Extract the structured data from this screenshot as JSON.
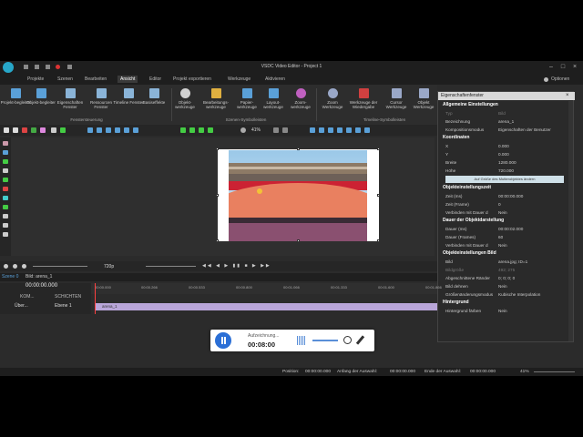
{
  "window": {
    "title": "VSDC Video Editor - Project 1"
  },
  "menu": {
    "items": [
      "Projekte",
      "Szenen",
      "Bearbeiten",
      "Ansicht",
      "Editor",
      "Projekt exportieren",
      "Werkzeuge",
      "Aktivieren"
    ],
    "options_label": "Optionen"
  },
  "ribbon": {
    "group1": [
      {
        "label": "Projekt-begleiter",
        "sub": "▾"
      },
      {
        "label": "Objekt-begleiter",
        "sub": "▾"
      },
      {
        "label": "Eigenschaften Fenster",
        "sub": "▾"
      },
      {
        "label": "Ressourcen Fenster",
        "sub": "▾"
      },
      {
        "label": "Timeline Fenster",
        "sub": "▾"
      },
      {
        "label": "Basiseffekte",
        "sub": ""
      }
    ],
    "group1_label": "Fenstersteuerung",
    "group2": [
      {
        "label": "Objekt-werkzeuge"
      },
      {
        "label": "Bearbeitungs-werkzeuge"
      },
      {
        "label": "Papier-werkzeuge"
      },
      {
        "label": "Layout-werkzeuge"
      },
      {
        "label": "Zoom-werkzeuge"
      }
    ],
    "group2_label": "Szenen-Symbolleisten",
    "group3": [
      {
        "label": "Zoom Werkzeuge"
      },
      {
        "label": "Werkzeuge der Wiedergabe"
      },
      {
        "label": "Cursor Werkzeuge"
      },
      {
        "label": "Objekt Werkzeuge"
      }
    ],
    "group3_label": "Timeline-Symbolleisten"
  },
  "toolbar2": {
    "zoom": "41%"
  },
  "playback_bar": {
    "resolution": "720p"
  },
  "properties": {
    "title": "Eigenschaftenfenster",
    "sections": [
      {
        "header": "Allgemeine Einstellungen",
        "rows": [
          {
            "k": "Typ",
            "v": "Bild",
            "dim": true
          },
          {
            "k": "Bezeichnung",
            "v": "arena_1"
          },
          {
            "k": "Kompositionsmodus",
            "v": "Eigenschaften der Benutzer"
          }
        ]
      },
      {
        "header": "Koordinaten",
        "rows": [
          {
            "k": "X",
            "v": "0.000"
          },
          {
            "k": "Y",
            "v": "0.000"
          },
          {
            "k": "Breite",
            "v": "1280.000"
          },
          {
            "k": "Höhe",
            "v": "720.000"
          }
        ],
        "button": "Auf Größe des Mutterobjektes ändern"
      },
      {
        "header": "Objekteinstellungszeit",
        "rows": [
          {
            "k": "Zeit (ms)",
            "v": "00:00:00.000"
          },
          {
            "k": "Zeit (Frame)",
            "v": "0"
          },
          {
            "k": "Verbinden mit Dauer d",
            "v": "Nein"
          }
        ]
      },
      {
        "header": "Dauer der Objektdarstellung",
        "rows": [
          {
            "k": "Dauer (ms)",
            "v": "00:00:02.000"
          },
          {
            "k": "Dauer (Frames)",
            "v": "60"
          },
          {
            "k": "Verbinden mit Dauer d",
            "v": "Nein"
          }
        ]
      },
      {
        "header": "Objekteinstellungen Bild",
        "rows": [
          {
            "k": "Bild",
            "v": "arena.jpg; ID=1"
          },
          {
            "k": "Bildgröße",
            "v": "492; 275",
            "dim": true
          },
          {
            "k": "Abgeschnittene Ränder",
            "v": "0; 0; 0; 0"
          },
          {
            "k": "Bild dehnen",
            "v": "Nein"
          },
          {
            "k": "Größenänderungsmodus",
            "v": "Kubische Interpolation"
          }
        ]
      },
      {
        "header": "Hintergrund",
        "rows": [
          {
            "k": "Hintergrund färben",
            "v": "Nein"
          }
        ]
      }
    ]
  },
  "tabs": {
    "scene": "Szene 0",
    "image": "Bild: arena_1"
  },
  "timeline": {
    "time": "00:00:00.000",
    "layers_label": "SCHICHTEN",
    "comp_label": "KOM...",
    "track_label": "Über...",
    "layer_name": "Ebene 1",
    "clip_name": "arena_1",
    "ruler": [
      "00:00.000",
      "00:00.266",
      "00:00.533",
      "00:00.800",
      "00:01.066",
      "00:01.333",
      "00:01.600",
      "00:01.866"
    ]
  },
  "recorder": {
    "label": "Aufzeichnung...",
    "time": "00:08:00"
  },
  "status": {
    "position_label": "Position:",
    "position": "00:00:00.000",
    "sel_start_label": "Anfang der Auswahl:",
    "sel_start": "00:00:00.000",
    "sel_end_label": "Ende der Auswahl:",
    "sel_end": "00:00:00.000",
    "zoom": "41%"
  },
  "colors": {
    "accent": "#2b6fd6",
    "clip": "#b9a6d9",
    "playhead": "#ff4040"
  }
}
